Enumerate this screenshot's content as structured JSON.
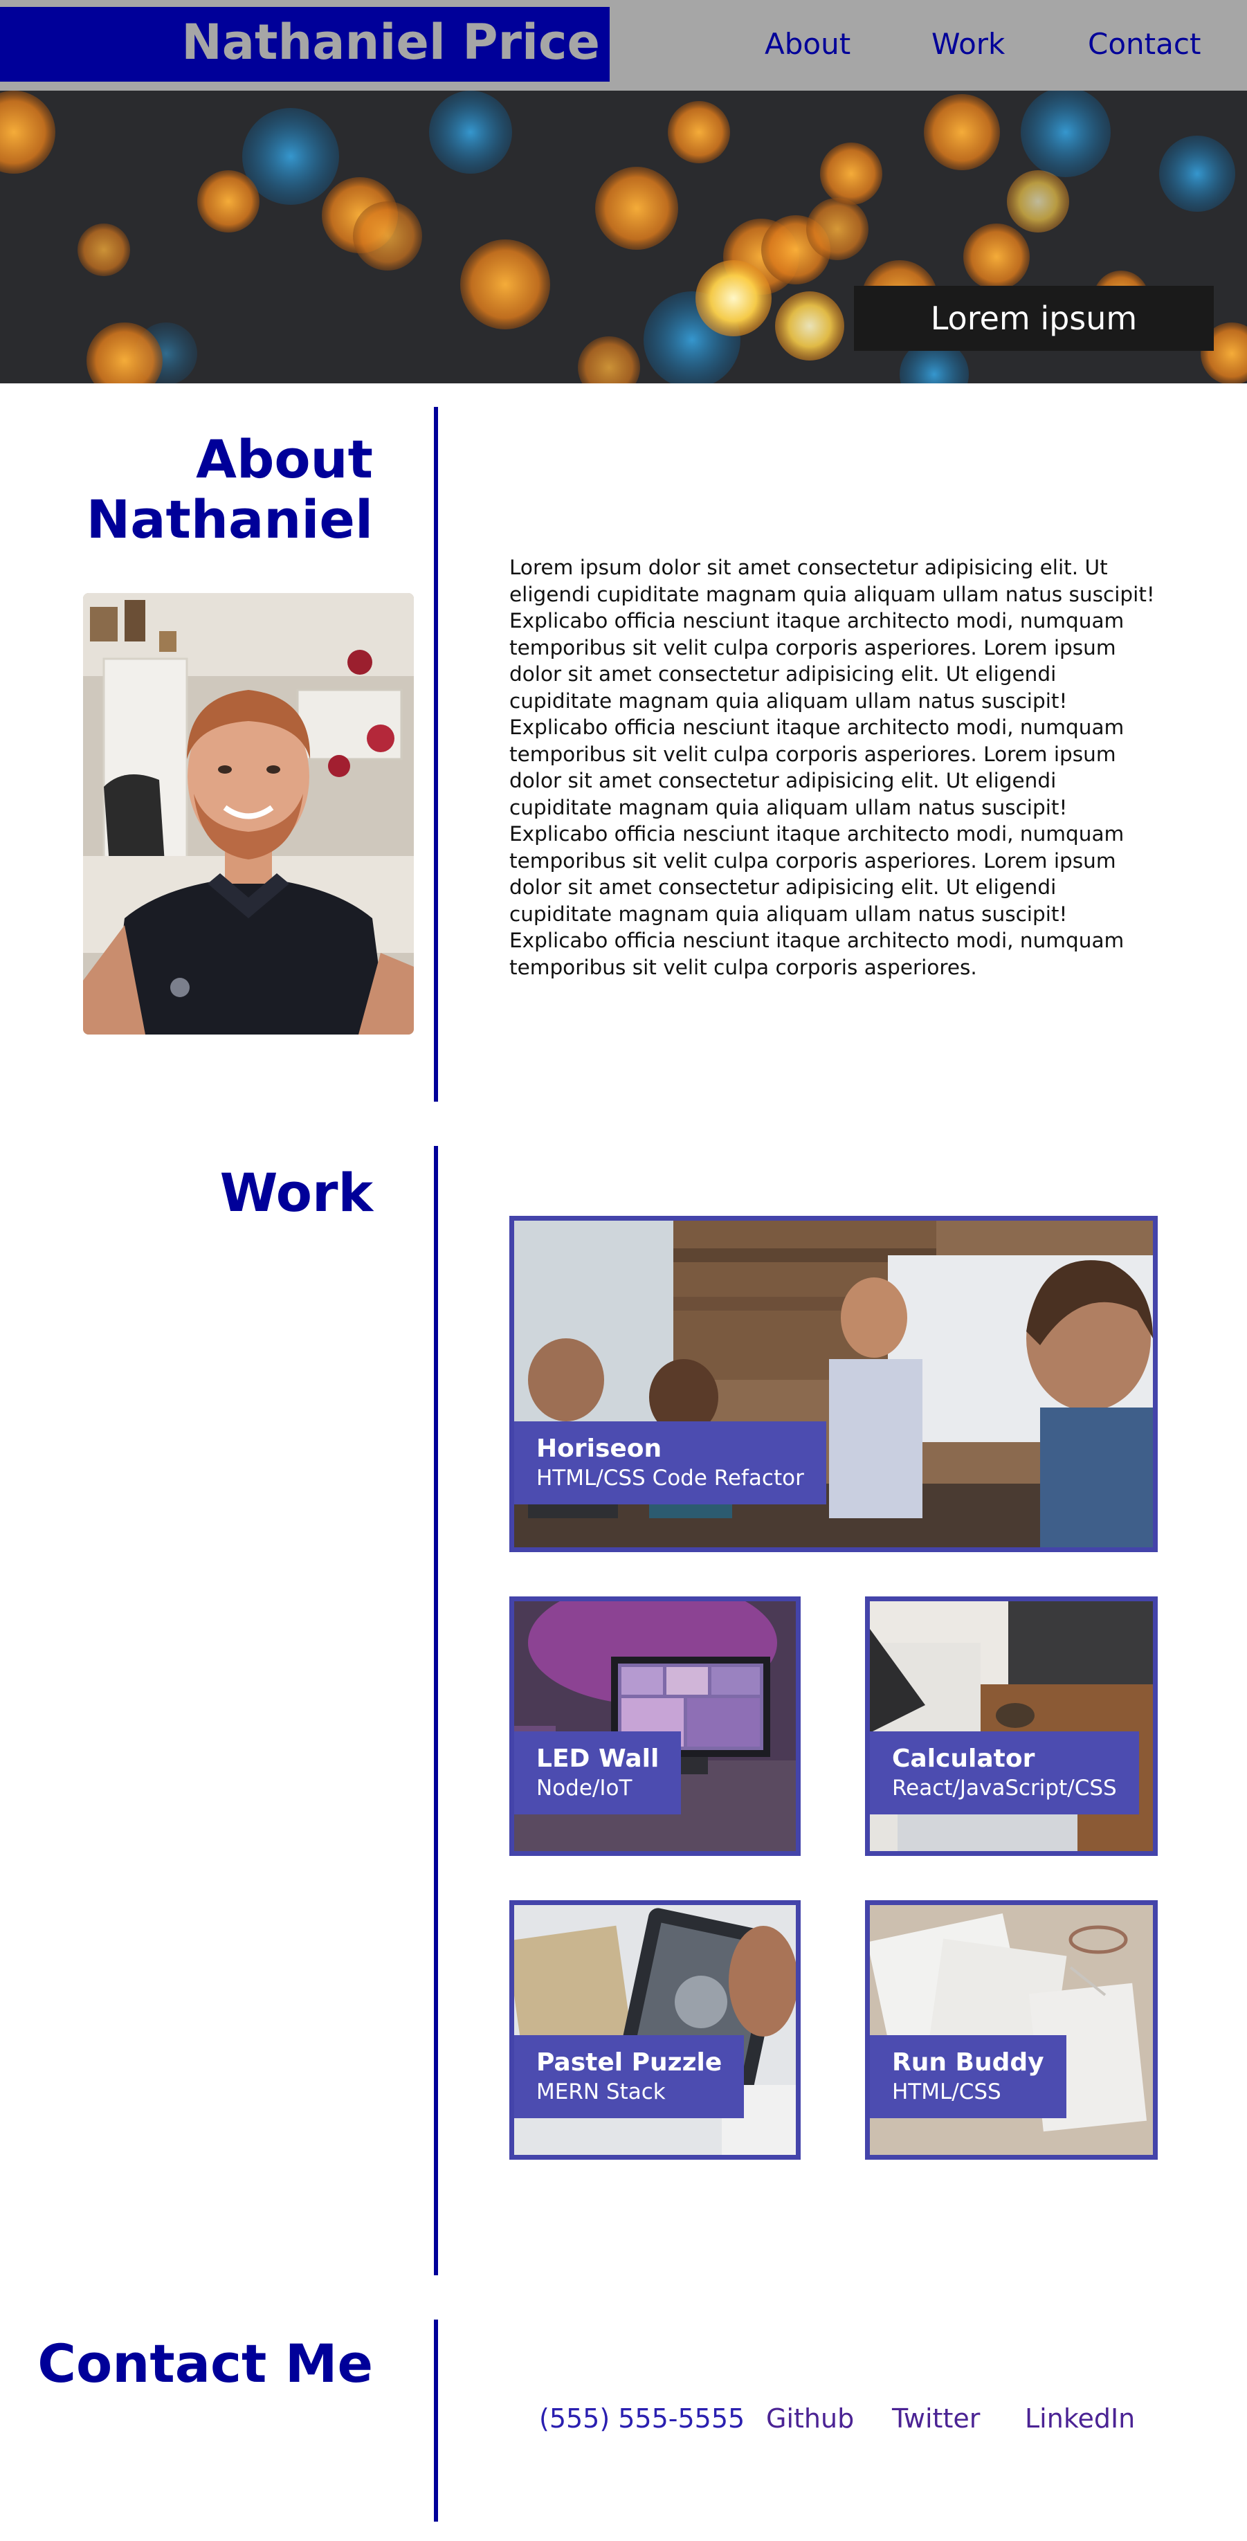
{
  "header": {
    "name": "Nathaniel Price",
    "nav": {
      "about": "About",
      "work": "Work",
      "contact": "Contact"
    }
  },
  "hero": {
    "badge": "Lorem ipsum"
  },
  "about": {
    "title_line1": "About",
    "title_line2": "Nathaniel",
    "photo_alt": "Photo of Nathaniel",
    "body": "Lorem ipsum dolor sit amet consectetur adipisicing elit. Ut eligendi cupiditate magnam quia aliquam ullam natus suscipit! Explicabo officia nesciunt itaque architecto modi, numquam temporibus sit velit culpa corporis asperiores. Lorem ipsum dolor sit amet consectetur adipisicing elit. Ut eligendi cupiditate magnam quia aliquam ullam natus suscipit! Explicabo officia nesciunt itaque architecto modi, numquam temporibus sit velit culpa corporis asperiores. Lorem ipsum dolor sit amet consectetur adipisicing elit. Ut eligendi cupiditate magnam quia aliquam ullam natus suscipit! Explicabo officia nesciunt itaque architecto modi, numquam temporibus sit velit culpa corporis asperiores. Lorem ipsum dolor sit amet consectetur adipisicing elit. Ut eligendi cupiditate magnam quia aliquam ullam natus suscipit! Explicabo officia nesciunt itaque architecto modi, numquam temporibus sit velit culpa corporis asperiores."
  },
  "work": {
    "title": "Work",
    "projects": [
      {
        "title": "Horiseon",
        "subtitle": "HTML/CSS Code Refactor"
      },
      {
        "title": "LED Wall",
        "subtitle": "Node/IoT"
      },
      {
        "title": "Calculator",
        "subtitle": "React/JavaScript/CSS"
      },
      {
        "title": "Pastel Puzzle",
        "subtitle": "MERN Stack"
      },
      {
        "title": "Run Buddy",
        "subtitle": "HTML/CSS"
      }
    ]
  },
  "contact": {
    "title": "Contact Me",
    "links": {
      "phone": "(555) 555-5555",
      "github": "Github",
      "twitter": "Twitter",
      "linkedin": "LinkedIn"
    }
  },
  "colors": {
    "brand_navy": "#000099",
    "header_gray": "#a6a6a6",
    "card_border": "#4444aa",
    "card_label": "#4c4cb0",
    "contact_link": "#4b2394"
  }
}
